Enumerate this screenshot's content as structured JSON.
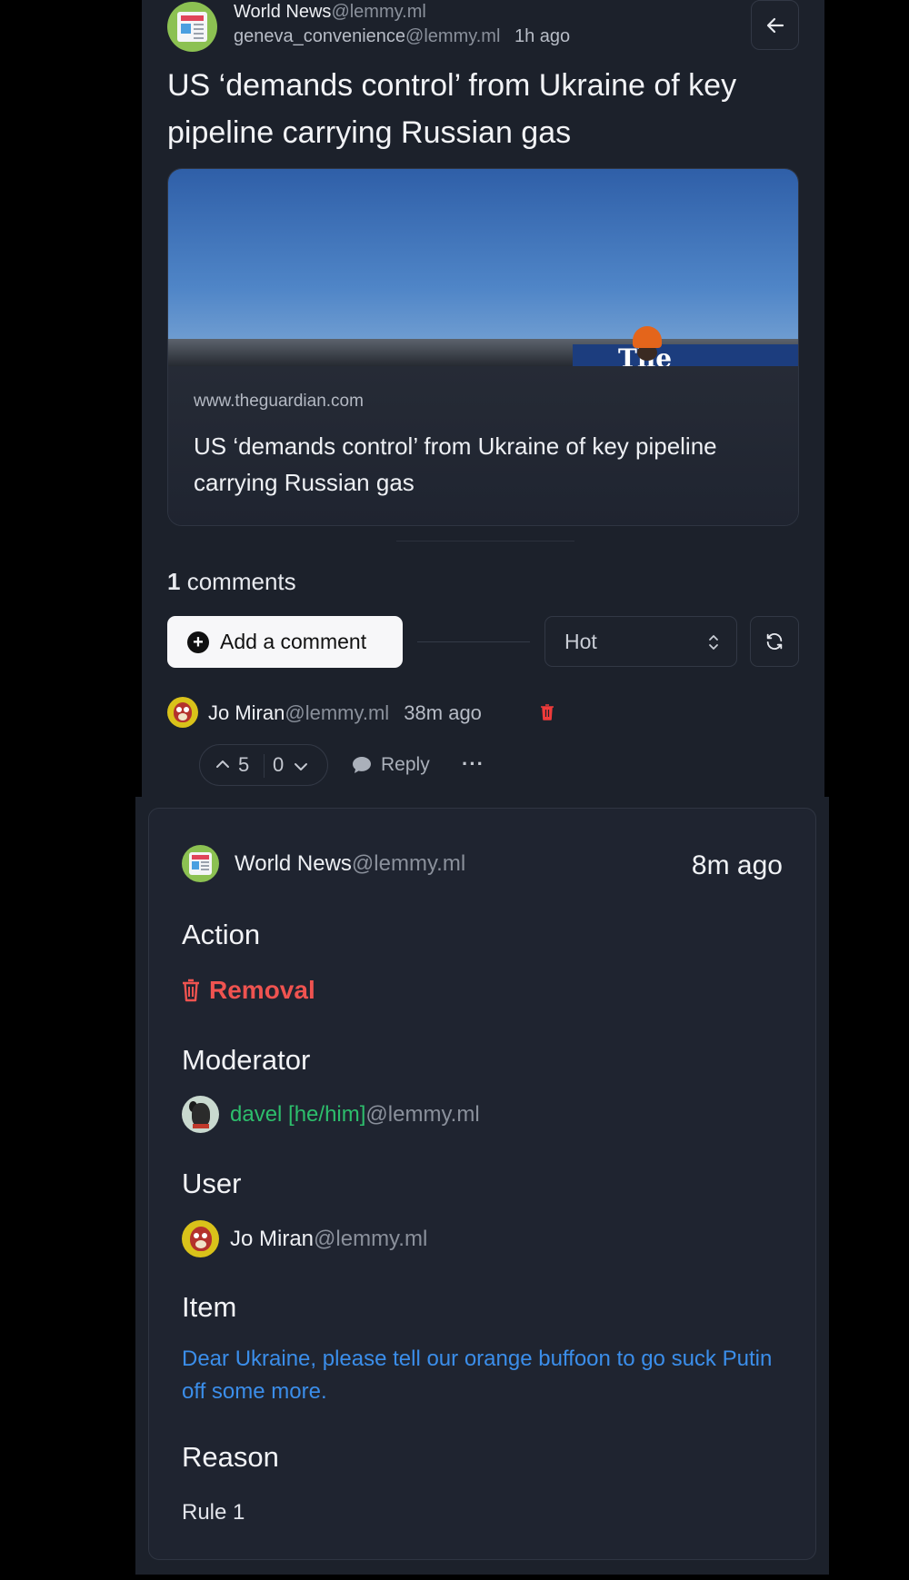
{
  "post": {
    "community_name": "World News",
    "community_instance": "@lemmy.ml",
    "author_name": "geneva_convenience",
    "author_instance": "@lemmy.ml",
    "age": "1h ago",
    "title": "US ‘demands control’ from Ukraine of key pipeline carrying Russian gas",
    "link": {
      "domain": "www.theguardian.com",
      "title": "US ‘demands control’ from Ukraine of key pipeline carrying Russian gas",
      "image_text": "The"
    }
  },
  "comments_section": {
    "count": "1",
    "count_label": "comments",
    "add_comment_label": "Add a comment",
    "sort_value": "Hot"
  },
  "comment": {
    "author_name": "Jo Miran",
    "author_instance": "@lemmy.ml",
    "age": "38m ago",
    "upvotes": "5",
    "downvotes": "0",
    "reply_label": "Reply",
    "more_label": "···"
  },
  "modlog": {
    "community_name": "World News",
    "community_instance": "@lemmy.ml",
    "time": "8m ago",
    "action_heading": "Action",
    "action_value": "Removal",
    "moderator_heading": "Moderator",
    "moderator_name": "davel [he/him]",
    "moderator_instance": "@lemmy.ml",
    "user_heading": "User",
    "user_name": "Jo Miran",
    "user_instance": "@lemmy.ml",
    "item_heading": "Item",
    "item_text": "Dear Ukraine, please tell our orange buffoon to go suck Putin off some more.",
    "reason_heading": "Reason",
    "reason_value": "Rule 1"
  },
  "colors": {
    "panel_bg": "#1c212b",
    "removal_red": "#ef5350",
    "moderator_green": "#2dbe6c",
    "link_blue": "#3b8eea"
  },
  "icons": [
    "community-avatar-icon",
    "back-arrow-icon",
    "plus-circle-icon",
    "chevron-updown-icon",
    "refresh-icon",
    "trash-icon",
    "chevron-up-icon",
    "chevron-down-icon",
    "speech-bubble-icon",
    "ellipsis-icon"
  ]
}
